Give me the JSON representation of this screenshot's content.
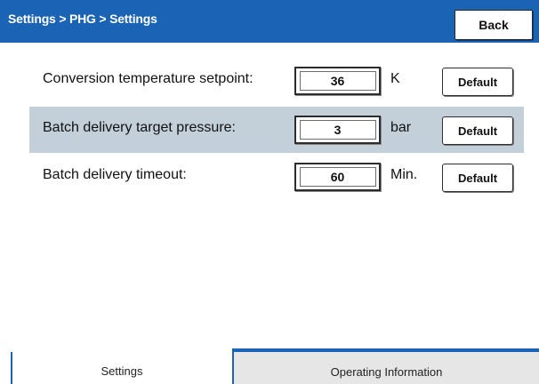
{
  "header": {
    "breadcrumb": "Settings > PHG > Settings",
    "back_label": "Back"
  },
  "rows": [
    {
      "label": "Conversion temperature setpoint:",
      "value": "36",
      "unit": "K",
      "default_label": "Default"
    },
    {
      "label": "Batch delivery target pressure:",
      "value": "3",
      "unit": "bar",
      "default_label": "Default"
    },
    {
      "label": "Batch delivery timeout:",
      "value": "60",
      "unit": "Min.",
      "default_label": "Default"
    }
  ],
  "tabs": [
    {
      "label": "Settings",
      "active": true
    },
    {
      "label": "Operating Information",
      "active": false
    }
  ],
  "colors": {
    "header_bg": "#1b63b5",
    "highlight_row": "#c3cfd9",
    "inactive_tab": "#e6e6e6"
  }
}
